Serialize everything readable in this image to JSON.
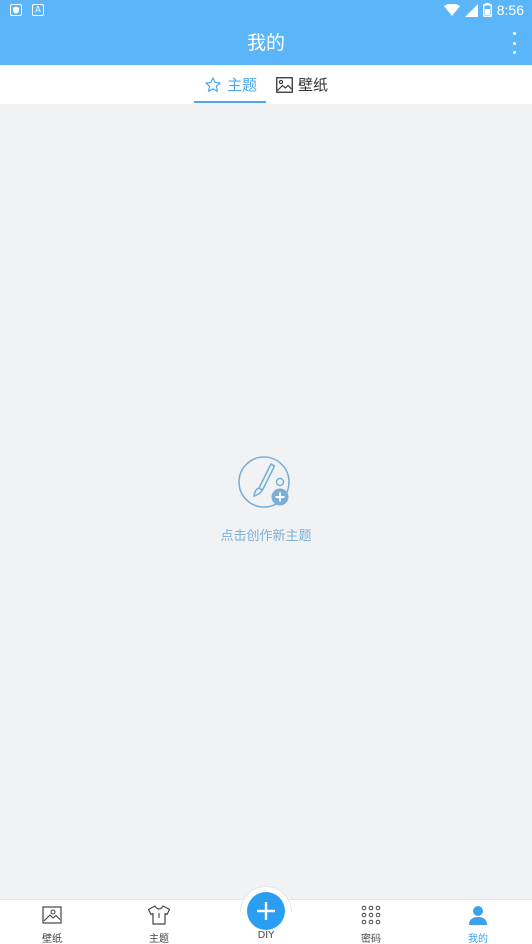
{
  "status_bar": {
    "time": "8:56",
    "left_icon_2": "A"
  },
  "app_bar": {
    "title": "我的"
  },
  "tabs": [
    {
      "label": "主题",
      "icon": "star-icon",
      "active": true
    },
    {
      "label": "壁纸",
      "icon": "image-icon",
      "active": false
    }
  ],
  "empty_state": {
    "hint": "点击创作新主题",
    "icon": "palette-brush-add-icon"
  },
  "bottom_nav": {
    "items": [
      {
        "label": "壁纸",
        "icon": "wallpaper-icon"
      },
      {
        "label": "主题",
        "icon": "tshirt-icon"
      },
      {
        "label": "DIY",
        "icon": "plus-icon"
      },
      {
        "label": "密码",
        "icon": "keypad-icon"
      },
      {
        "label": "我的",
        "icon": "person-icon",
        "active": true
      }
    ]
  },
  "colors": {
    "accent": "#5ab6f8",
    "active_tab": "#4aa8ee",
    "diy_button": "#2a9ef0",
    "hint_text": "#7ab0d8",
    "background": "#f1f2f4"
  }
}
